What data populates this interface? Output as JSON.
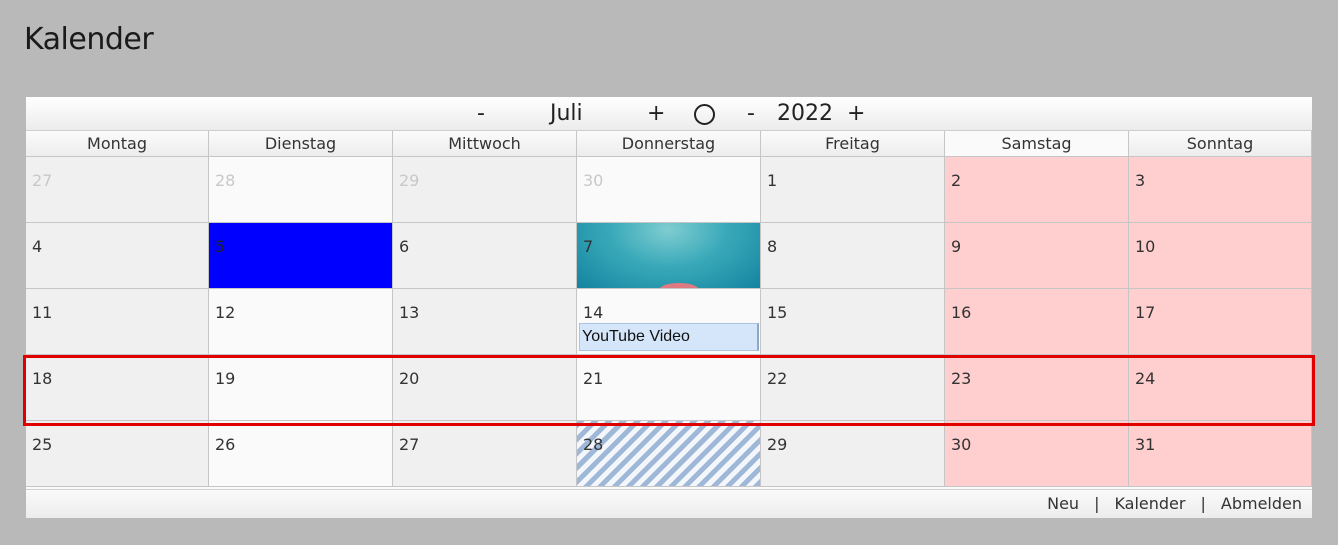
{
  "page_title": "Kalender",
  "nav": {
    "month_prev": "-",
    "month": "Juli",
    "month_next": "+",
    "today_icon": "circle-icon",
    "year_prev": "-",
    "year": "2022",
    "year_next": "+"
  },
  "weekdays": [
    "Montag",
    "Dienstag",
    "Mittwoch",
    "Donnerstag",
    "Freitag",
    "Samstag",
    "Sonntag"
  ],
  "weeks": [
    [
      "27",
      "28",
      "29",
      "30",
      "1",
      "2",
      "3"
    ],
    [
      "4",
      "5",
      "6",
      "7",
      "8",
      "9",
      "10"
    ],
    [
      "11",
      "12",
      "13",
      "14",
      "15",
      "16",
      "17"
    ],
    [
      "18",
      "19",
      "20",
      "21",
      "22",
      "23",
      "24"
    ],
    [
      "25",
      "26",
      "27",
      "28",
      "29",
      "30",
      "31"
    ]
  ],
  "events": {
    "thursday_14": "YouTube Video"
  },
  "footer": {
    "new": "Neu",
    "sep1": "|",
    "calendar": "Kalender",
    "sep2": "|",
    "logout": "Abmelden"
  },
  "colors": {
    "weekend": "#ffcece",
    "blue_day": "#0000ff",
    "highlight": "#e00000",
    "event": "#d5e6fa"
  }
}
